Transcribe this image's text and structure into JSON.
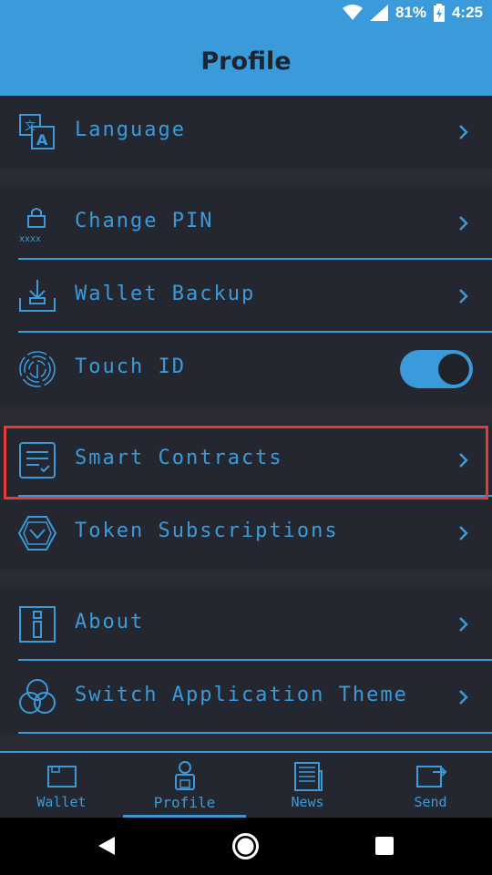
{
  "status": {
    "battery": "81%",
    "time": "4:25"
  },
  "appbar": {
    "title": "Profile"
  },
  "settings": {
    "items": [
      {
        "label": "Language",
        "icon": "language-icon"
      },
      {
        "label": "Change PIN",
        "icon": "pin-icon"
      },
      {
        "label": "Wallet Backup",
        "icon": "backup-icon"
      },
      {
        "label": "Touch ID",
        "icon": "fingerprint-icon",
        "toggle_on": true
      },
      {
        "label": "Smart Contracts",
        "icon": "contract-icon"
      },
      {
        "label": "Token Subscriptions",
        "icon": "token-icon"
      },
      {
        "label": "About",
        "icon": "info-icon"
      },
      {
        "label": "Switch Application Theme",
        "icon": "theme-icon"
      }
    ]
  },
  "bottomnav": {
    "items": [
      {
        "label": "Wallet",
        "icon": "wallet-icon"
      },
      {
        "label": "Profile",
        "icon": "profile-icon",
        "active": true
      },
      {
        "label": "News",
        "icon": "news-icon"
      },
      {
        "label": "Send",
        "icon": "send-icon"
      }
    ]
  },
  "colors": {
    "accent": "#3b9ad9",
    "background": "#252730",
    "highlight": "#e5393b"
  }
}
